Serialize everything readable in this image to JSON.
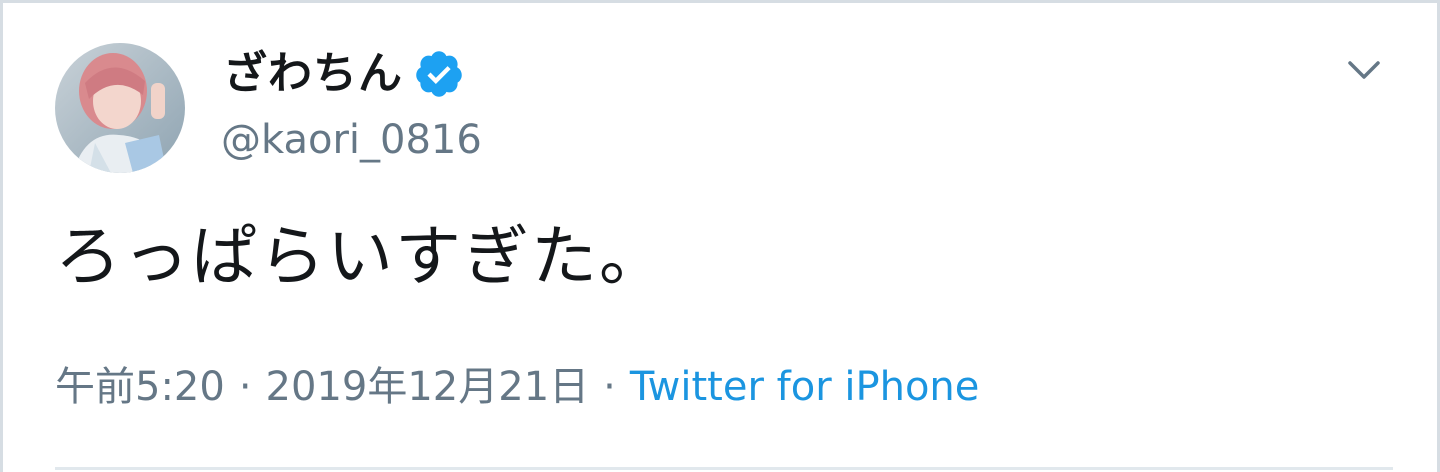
{
  "tweet": {
    "author": {
      "display_name": "ざわちん",
      "handle": "@kaori_0816",
      "verified": true,
      "avatar": "profile-photo"
    },
    "text": "ろっぱらいすぎた。",
    "meta": {
      "time": "午前5:20",
      "separator": "·",
      "date": "2019年12月21日",
      "source": "Twitter for iPhone"
    },
    "menu_icon": "chevron-down-icon"
  },
  "colors": {
    "text_primary": "#14171a",
    "text_secondary": "#657786",
    "link": "#1b95e0",
    "verified": "#1da1f2",
    "border": "#d6dde3"
  }
}
